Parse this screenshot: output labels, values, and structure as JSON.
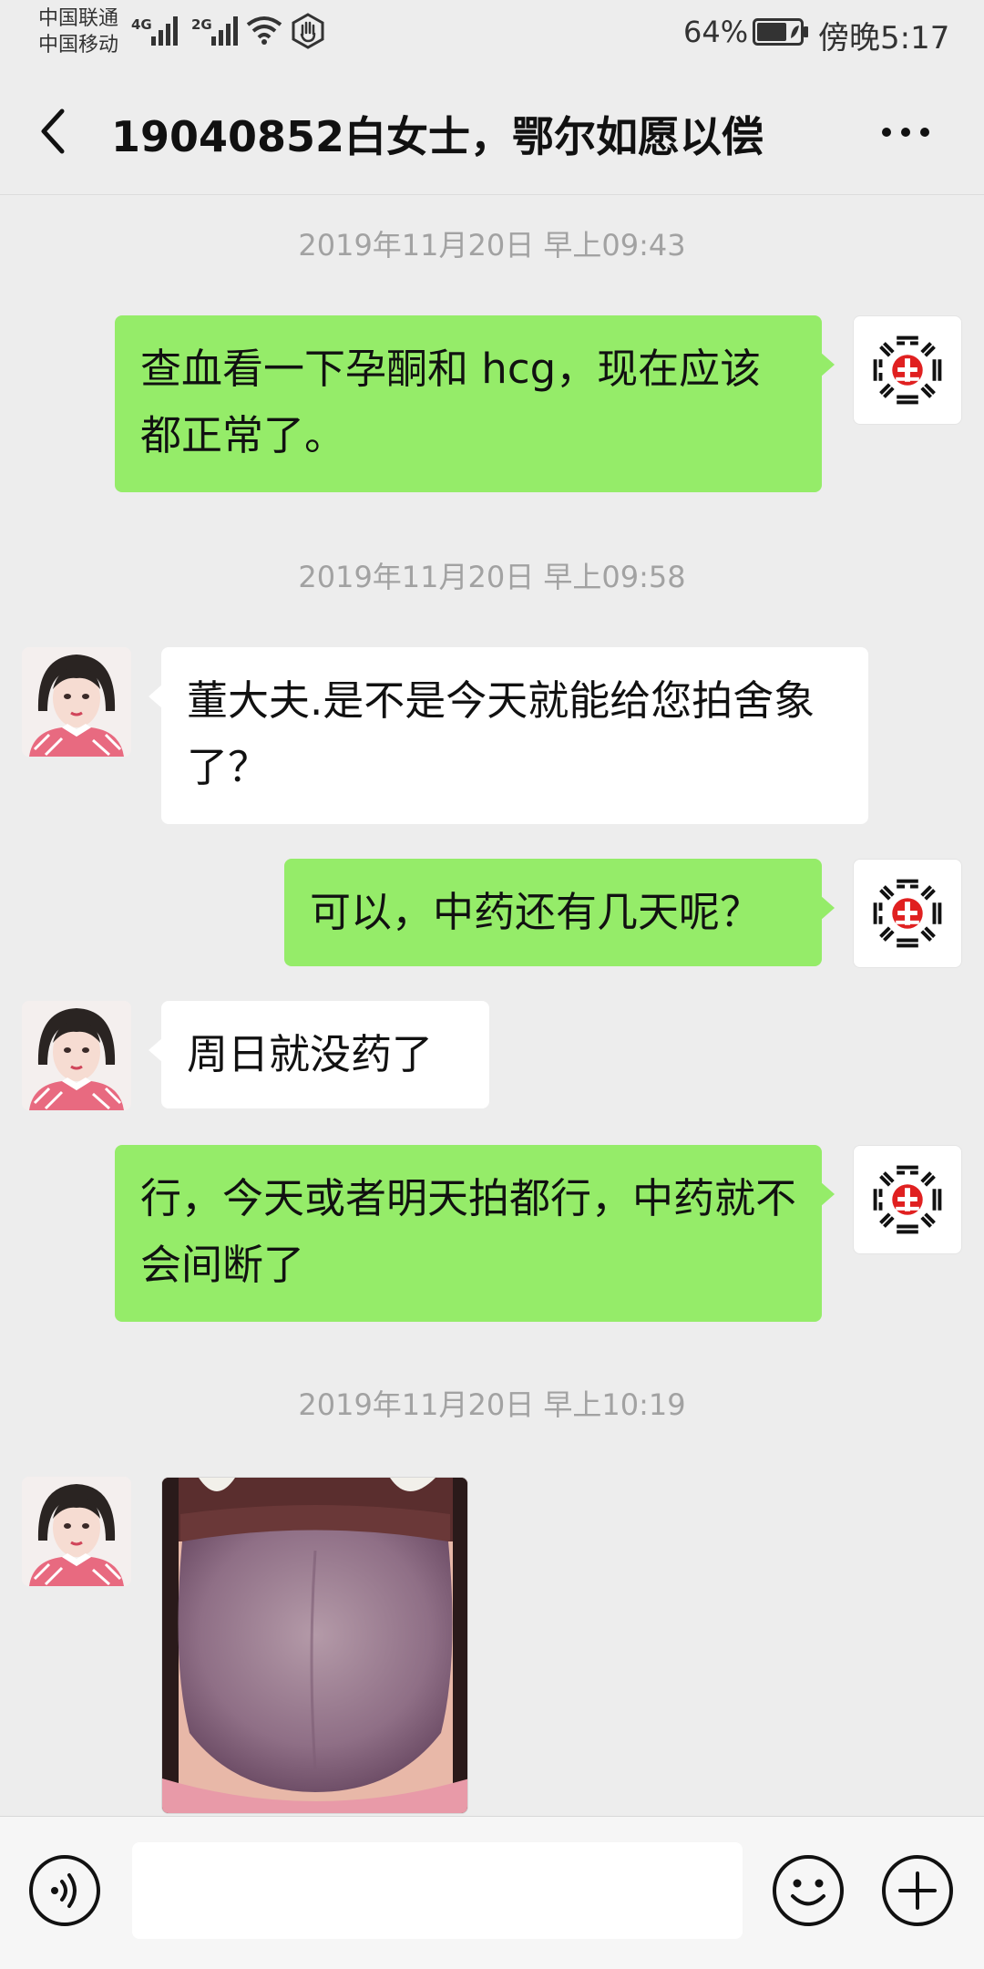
{
  "status_bar": {
    "carrier_1": "中国联通",
    "carrier_2": "中国移动",
    "net_1": "4G",
    "net_2": "2G",
    "battery_percent": "64%",
    "time": "傍晚5:17"
  },
  "header": {
    "title": "19040852白女士，鄂尔如愿以偿"
  },
  "messages": [
    {
      "type": "timestamp",
      "text": "2019年11月20日 早上09:43"
    },
    {
      "type": "text",
      "sender": "me",
      "text": "查血看一下孕酮和 hcg，现在应该都正常了。"
    },
    {
      "type": "timestamp",
      "text": "2019年11月20日 早上09:58"
    },
    {
      "type": "text",
      "sender": "them",
      "text": "董大夫.是不是今天就能给您拍舍象了？"
    },
    {
      "type": "text",
      "sender": "me",
      "text": "可以，中药还有几天呢？"
    },
    {
      "type": "text",
      "sender": "them",
      "text": "周日就没药了"
    },
    {
      "type": "text",
      "sender": "me",
      "text": "行，今天或者明天拍都行，中药就不会间断了"
    },
    {
      "type": "timestamp",
      "text": "2019年11月20日 早上10:19"
    },
    {
      "type": "image",
      "sender": "them",
      "content": "tongue-photo"
    }
  ],
  "input_bar": {
    "placeholder": ""
  },
  "icons": {
    "back": "back-arrow-icon",
    "more": "more-dots-icon",
    "voice": "voice-icon",
    "emoji": "emoji-icon",
    "plus": "plus-icon",
    "logo": "bagua-logo-icon"
  },
  "colors": {
    "background": "#ededed",
    "my_bubble": "#95ec69",
    "their_bubble": "#ffffff",
    "timestamp_text": "#a2a2a2"
  }
}
